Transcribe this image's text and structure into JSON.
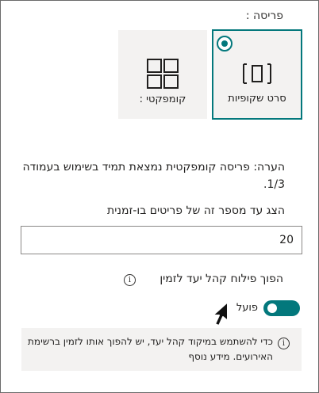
{
  "layout": {
    "label": "פריסה :",
    "options": [
      {
        "id": "filmstrip",
        "label": "סרט שקופיות",
        "selected": true
      },
      {
        "id": "compact",
        "label": "קומפקטי :",
        "selected": false
      }
    ]
  },
  "note": {
    "text": "הערה: פריסה קומפקטית נמצאת תמיד בשימוש בעמודה 1/3."
  },
  "count": {
    "label": "הצג עד מספר זה של פריטים בו-זמנית",
    "value": "20"
  },
  "audience": {
    "label": "הפוך פילוח קהל יעד לזמין",
    "toggle_state": "פועל",
    "toggle_on": true
  },
  "infobox": {
    "text": "כדי להשתמש במיקוד קהל יעד, יש להפוך אותו לזמין ברשימת האירועים.",
    "link": "מידע נוסף"
  },
  "colors": {
    "accent": "#03787c",
    "card_bg": "#f3f2f1"
  }
}
